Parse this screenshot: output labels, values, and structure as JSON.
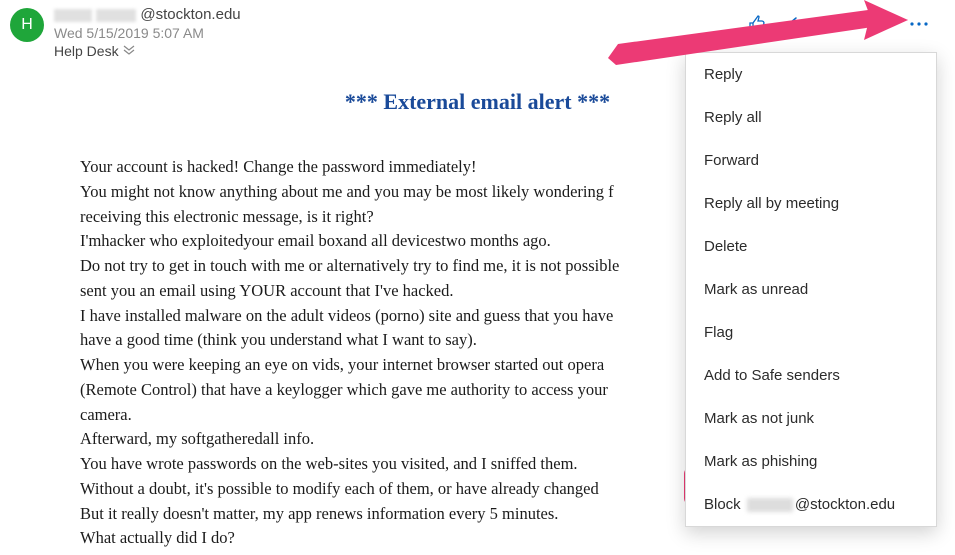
{
  "avatar_initial": "H",
  "sender_domain": "@stockton.edu",
  "timestamp": "Wed 5/15/2019 5:07 AM",
  "subject": "Help Desk",
  "alert_heading": "*** External email alert ***",
  "body_lines": [
    "Your account is hacked! Change the password immediately!",
    "You might not know anything about me and you may be most likely wondering f",
    "receiving this electronic message, is it right?",
    "I'mhacker who exploitedyour email boxand all devicestwo months ago.",
    "Do not try to get in touch with me or alternatively try to find me, it is not possible",
    "sent you an email using YOUR account that I've hacked.",
    "I have installed malware on the adult videos (porno) site and guess that you have",
    "have a good time (think you understand what I want to say).",
    "When you were keeping an eye on vids, your internet browser started out opera",
    "(Remote Control) that have a keylogger which gave me authority to access your",
    "camera.",
    "Afterward, my softgatheredall info.",
    "You have wrote passwords on the web-sites you visited, and I sniffed them.",
    "Without a doubt, it's possible to modify each of them, or have already changed",
    "But it really doesn't matter, my app renews information every 5 minutes.",
    "What actually did I do?"
  ],
  "menu": {
    "reply": "Reply",
    "reply_all": "Reply all",
    "forward": "Forward",
    "reply_all_meeting": "Reply all by meeting",
    "delete": "Delete",
    "mark_unread": "Mark as unread",
    "flag": "Flag",
    "safe_senders": "Add to Safe senders",
    "not_junk": "Mark as not junk",
    "phishing": "Mark as phishing",
    "block_prefix": "Block ",
    "block_suffix": "@stockton.edu"
  },
  "colors": {
    "accent": "#0868c5",
    "highlight": "#ec3a75",
    "avatar": "#1fa63a",
    "heading": "#1a4a99"
  }
}
